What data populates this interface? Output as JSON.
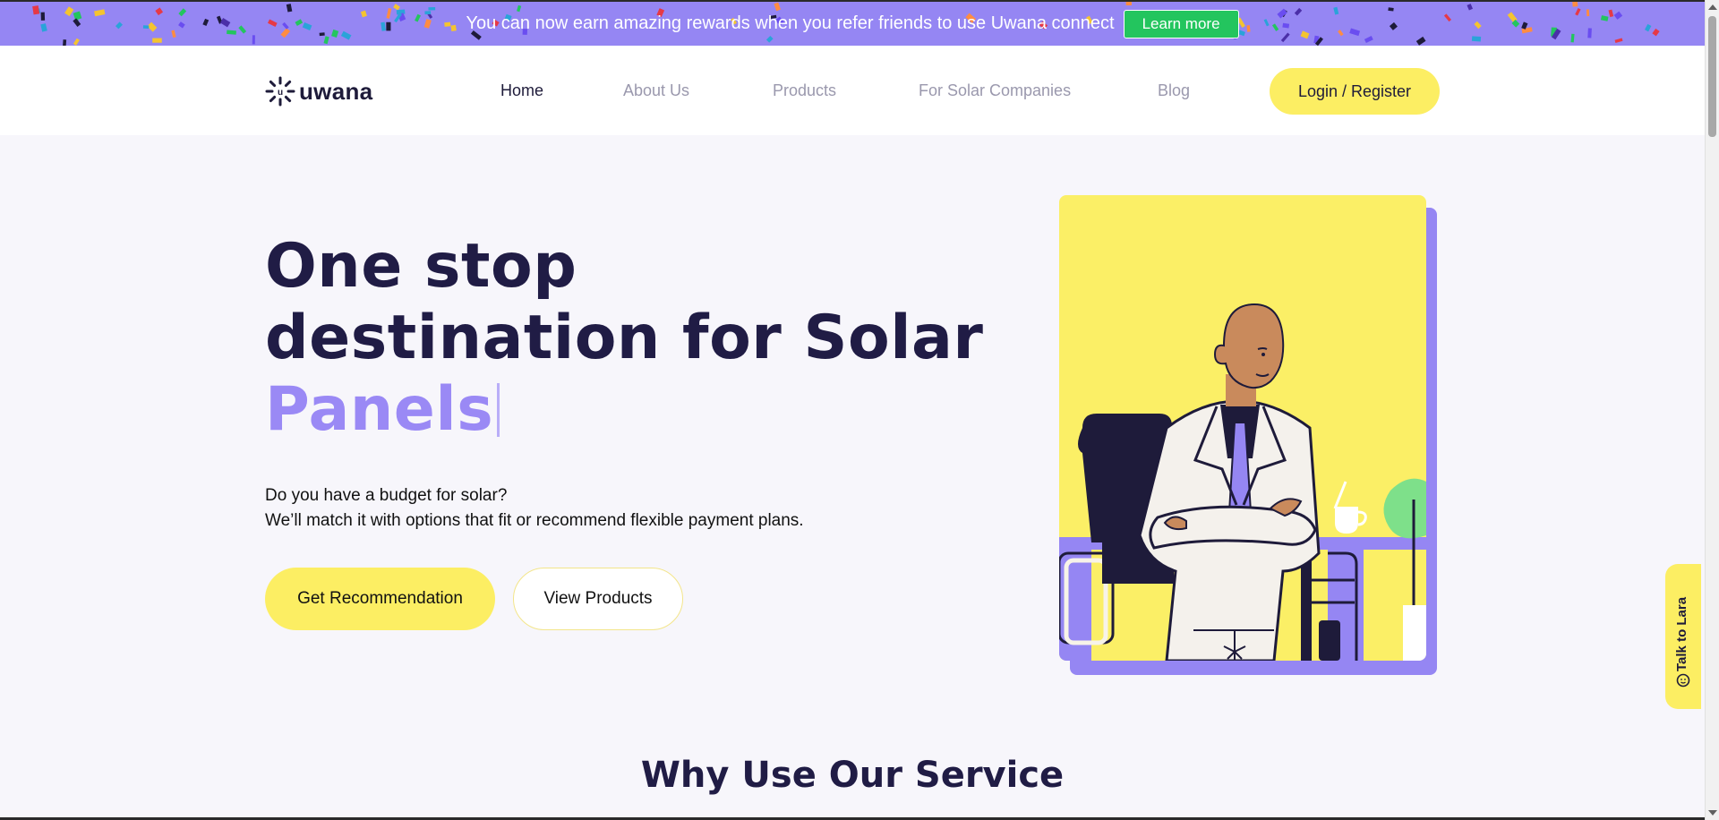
{
  "promo": {
    "text": "You can now earn amazing rewards when you refer friends to use Uwana connect",
    "button": "Learn more"
  },
  "header": {
    "logo_text": "uwana",
    "nav": [
      "Home",
      "About Us",
      "Products",
      "For Solar Companies",
      "Blog"
    ],
    "active": "Home",
    "login": "Login / Register"
  },
  "hero": {
    "title_line1": "One stop",
    "title_line2": "destination for Solar",
    "title_accent": "Panels",
    "sub_line1": "Do you have a budget for solar?",
    "sub_line2": "We’ll match it with options that fit or recommend flexible payment plans.",
    "primary_button": "Get Recommendation",
    "secondary_button": "View Products"
  },
  "section": {
    "title": "Why Use Our Service"
  },
  "side_tab": {
    "label": "Talk to Lara",
    "icon": "chat-icon"
  },
  "colors": {
    "brand_purple": "#9586f3",
    "brand_yellow": "#fcee63",
    "heading": "#201c45",
    "accent_text": "#9a89f5",
    "promo_button": "#23c55e"
  }
}
